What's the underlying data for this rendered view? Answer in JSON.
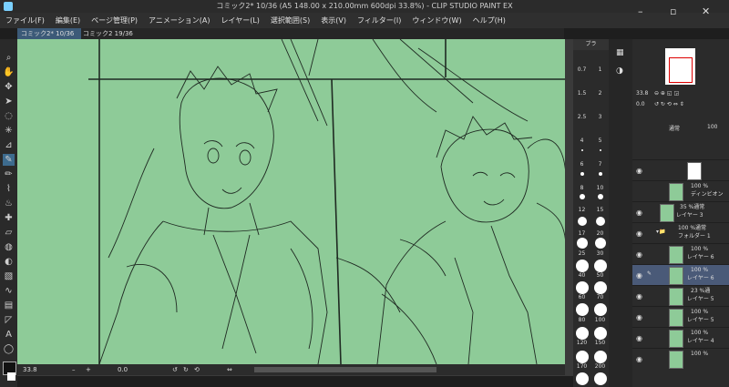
{
  "window": {
    "title": "コミック2* 10/36 (A5 148.00 x 210.00mm 600dpi 33.8%) - CLIP STUDIO PAINT EX"
  },
  "menu": [
    "ファイル(F)",
    "編集(E)",
    "ページ管理(P)",
    "アニメーション(A)",
    "レイヤー(L)",
    "選択範囲(S)",
    "表示(V)",
    "フィルター(I)",
    "ウィンドウ(W)",
    "ヘルプ(H)"
  ],
  "tabs": [
    {
      "label": "コミック2* 10/36",
      "active": true
    },
    {
      "label": "コミック2 19/36",
      "active": false
    }
  ],
  "status": {
    "zoom": "33.8",
    "angle": "0.0"
  },
  "brush_panel": {
    "header": "ブラ",
    "sizes": [
      "0.7",
      "1",
      "1.5",
      "2",
      "2.5",
      "3",
      "4",
      "5",
      "6",
      "7",
      "8",
      "10",
      "12",
      "15",
      "17",
      "20",
      "25",
      "30",
      "40",
      "50",
      "60",
      "70",
      "80",
      "100",
      "120",
      "150",
      "170",
      "200"
    ]
  },
  "navigator": {
    "zoom": "33.8",
    "angle": "0.0"
  },
  "layer_panel": {
    "blend_mode": "通常",
    "opacity": "100",
    "layers": [
      {
        "name": "",
        "opacity": "",
        "indent": 0
      },
      {
        "name": "ディンビオン",
        "opacity": "100 %",
        "indent": 0
      },
      {
        "name": "レイヤー 3",
        "opacity": "35 %通常",
        "indent": 0
      },
      {
        "name": "フォルダー 1",
        "opacity": "100 %通常",
        "indent": 0
      },
      {
        "name": "レイヤー 6",
        "opacity": "100 %",
        "indent": 1
      },
      {
        "name": "レイヤー 6",
        "opacity": "100 %",
        "indent": 1,
        "selected": true
      },
      {
        "name": "レイヤー 5",
        "opacity": "23 %通",
        "indent": 1
      },
      {
        "name": "レイヤー 5",
        "opacity": "100 %",
        "indent": 1
      },
      {
        "name": "レイヤー 4",
        "opacity": "100 %",
        "indent": 1
      },
      {
        "name": "",
        "opacity": "100 %",
        "indent": 1
      }
    ]
  },
  "colors": {
    "canvas_bg": "#8ecb98",
    "accent": "#3d6b8e",
    "sketch_line": "#1f2a22"
  }
}
